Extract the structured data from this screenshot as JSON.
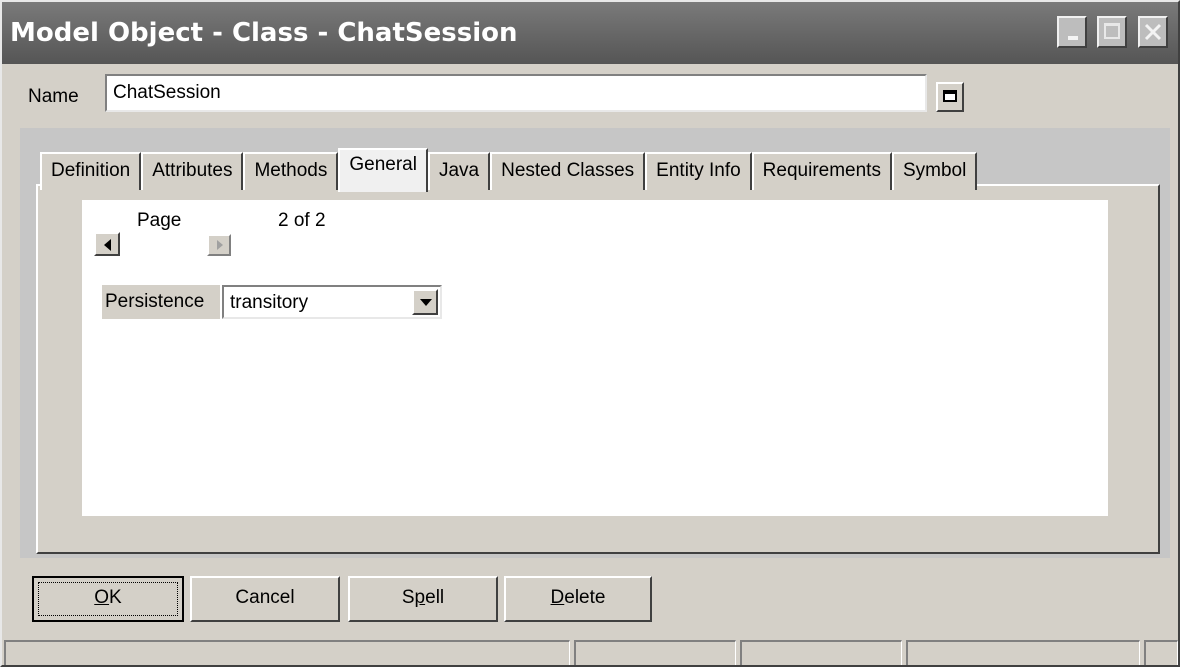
{
  "window": {
    "title": "Model Object - Class - ChatSession",
    "controls": [
      "minimize-icon",
      "maximize-icon",
      "close-icon"
    ]
  },
  "name_field": {
    "label": "Name",
    "value": "ChatSession"
  },
  "tabs": [
    {
      "label": "Definition",
      "active": false
    },
    {
      "label": "Attributes",
      "active": false
    },
    {
      "label": "Methods",
      "active": false
    },
    {
      "label": "General",
      "active": true
    },
    {
      "label": "Java",
      "active": false
    },
    {
      "label": "Nested Classes",
      "active": false
    },
    {
      "label": "Entity Info",
      "active": false
    },
    {
      "label": "Requirements",
      "active": false
    },
    {
      "label": "Symbol",
      "active": false
    }
  ],
  "pager": {
    "label": "Page",
    "count": "2 of 2"
  },
  "persistence": {
    "label": "Persistence",
    "value": "transitory"
  },
  "buttons": {
    "ok_pre": "",
    "ok_accel": "O",
    "ok_post": "K",
    "cancel": "Cancel",
    "spell_pre": "S",
    "spell_accel": "p",
    "spell_post": "ell",
    "delete_accel": "D",
    "delete_post": "elete"
  },
  "statusbar": {
    "cells": [
      "",
      "",
      "",
      "",
      ""
    ]
  }
}
